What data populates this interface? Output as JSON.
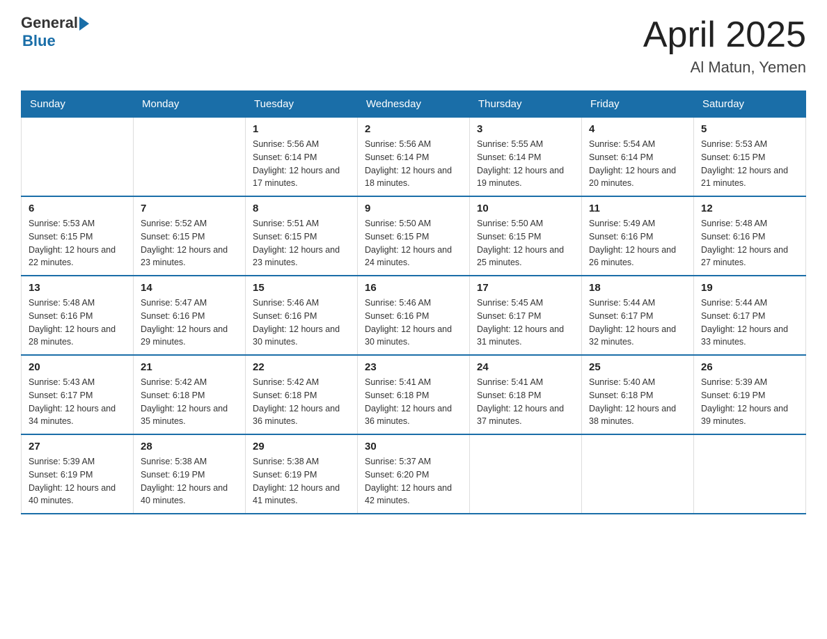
{
  "logo": {
    "general": "General",
    "blue": "Blue"
  },
  "title": "April 2025",
  "subtitle": "Al Matun, Yemen",
  "days_header": [
    "Sunday",
    "Monday",
    "Tuesday",
    "Wednesday",
    "Thursday",
    "Friday",
    "Saturday"
  ],
  "weeks": [
    [
      {
        "day": "",
        "sunrise": "",
        "sunset": "",
        "daylight": ""
      },
      {
        "day": "",
        "sunrise": "",
        "sunset": "",
        "daylight": ""
      },
      {
        "day": "1",
        "sunrise": "Sunrise: 5:56 AM",
        "sunset": "Sunset: 6:14 PM",
        "daylight": "Daylight: 12 hours and 17 minutes."
      },
      {
        "day": "2",
        "sunrise": "Sunrise: 5:56 AM",
        "sunset": "Sunset: 6:14 PM",
        "daylight": "Daylight: 12 hours and 18 minutes."
      },
      {
        "day": "3",
        "sunrise": "Sunrise: 5:55 AM",
        "sunset": "Sunset: 6:14 PM",
        "daylight": "Daylight: 12 hours and 19 minutes."
      },
      {
        "day": "4",
        "sunrise": "Sunrise: 5:54 AM",
        "sunset": "Sunset: 6:14 PM",
        "daylight": "Daylight: 12 hours and 20 minutes."
      },
      {
        "day": "5",
        "sunrise": "Sunrise: 5:53 AM",
        "sunset": "Sunset: 6:15 PM",
        "daylight": "Daylight: 12 hours and 21 minutes."
      }
    ],
    [
      {
        "day": "6",
        "sunrise": "Sunrise: 5:53 AM",
        "sunset": "Sunset: 6:15 PM",
        "daylight": "Daylight: 12 hours and 22 minutes."
      },
      {
        "day": "7",
        "sunrise": "Sunrise: 5:52 AM",
        "sunset": "Sunset: 6:15 PM",
        "daylight": "Daylight: 12 hours and 23 minutes."
      },
      {
        "day": "8",
        "sunrise": "Sunrise: 5:51 AM",
        "sunset": "Sunset: 6:15 PM",
        "daylight": "Daylight: 12 hours and 23 minutes."
      },
      {
        "day": "9",
        "sunrise": "Sunrise: 5:50 AM",
        "sunset": "Sunset: 6:15 PM",
        "daylight": "Daylight: 12 hours and 24 minutes."
      },
      {
        "day": "10",
        "sunrise": "Sunrise: 5:50 AM",
        "sunset": "Sunset: 6:15 PM",
        "daylight": "Daylight: 12 hours and 25 minutes."
      },
      {
        "day": "11",
        "sunrise": "Sunrise: 5:49 AM",
        "sunset": "Sunset: 6:16 PM",
        "daylight": "Daylight: 12 hours and 26 minutes."
      },
      {
        "day": "12",
        "sunrise": "Sunrise: 5:48 AM",
        "sunset": "Sunset: 6:16 PM",
        "daylight": "Daylight: 12 hours and 27 minutes."
      }
    ],
    [
      {
        "day": "13",
        "sunrise": "Sunrise: 5:48 AM",
        "sunset": "Sunset: 6:16 PM",
        "daylight": "Daylight: 12 hours and 28 minutes."
      },
      {
        "day": "14",
        "sunrise": "Sunrise: 5:47 AM",
        "sunset": "Sunset: 6:16 PM",
        "daylight": "Daylight: 12 hours and 29 minutes."
      },
      {
        "day": "15",
        "sunrise": "Sunrise: 5:46 AM",
        "sunset": "Sunset: 6:16 PM",
        "daylight": "Daylight: 12 hours and 30 minutes."
      },
      {
        "day": "16",
        "sunrise": "Sunrise: 5:46 AM",
        "sunset": "Sunset: 6:16 PM",
        "daylight": "Daylight: 12 hours and 30 minutes."
      },
      {
        "day": "17",
        "sunrise": "Sunrise: 5:45 AM",
        "sunset": "Sunset: 6:17 PM",
        "daylight": "Daylight: 12 hours and 31 minutes."
      },
      {
        "day": "18",
        "sunrise": "Sunrise: 5:44 AM",
        "sunset": "Sunset: 6:17 PM",
        "daylight": "Daylight: 12 hours and 32 minutes."
      },
      {
        "day": "19",
        "sunrise": "Sunrise: 5:44 AM",
        "sunset": "Sunset: 6:17 PM",
        "daylight": "Daylight: 12 hours and 33 minutes."
      }
    ],
    [
      {
        "day": "20",
        "sunrise": "Sunrise: 5:43 AM",
        "sunset": "Sunset: 6:17 PM",
        "daylight": "Daylight: 12 hours and 34 minutes."
      },
      {
        "day": "21",
        "sunrise": "Sunrise: 5:42 AM",
        "sunset": "Sunset: 6:18 PM",
        "daylight": "Daylight: 12 hours and 35 minutes."
      },
      {
        "day": "22",
        "sunrise": "Sunrise: 5:42 AM",
        "sunset": "Sunset: 6:18 PM",
        "daylight": "Daylight: 12 hours and 36 minutes."
      },
      {
        "day": "23",
        "sunrise": "Sunrise: 5:41 AM",
        "sunset": "Sunset: 6:18 PM",
        "daylight": "Daylight: 12 hours and 36 minutes."
      },
      {
        "day": "24",
        "sunrise": "Sunrise: 5:41 AM",
        "sunset": "Sunset: 6:18 PM",
        "daylight": "Daylight: 12 hours and 37 minutes."
      },
      {
        "day": "25",
        "sunrise": "Sunrise: 5:40 AM",
        "sunset": "Sunset: 6:18 PM",
        "daylight": "Daylight: 12 hours and 38 minutes."
      },
      {
        "day": "26",
        "sunrise": "Sunrise: 5:39 AM",
        "sunset": "Sunset: 6:19 PM",
        "daylight": "Daylight: 12 hours and 39 minutes."
      }
    ],
    [
      {
        "day": "27",
        "sunrise": "Sunrise: 5:39 AM",
        "sunset": "Sunset: 6:19 PM",
        "daylight": "Daylight: 12 hours and 40 minutes."
      },
      {
        "day": "28",
        "sunrise": "Sunrise: 5:38 AM",
        "sunset": "Sunset: 6:19 PM",
        "daylight": "Daylight: 12 hours and 40 minutes."
      },
      {
        "day": "29",
        "sunrise": "Sunrise: 5:38 AM",
        "sunset": "Sunset: 6:19 PM",
        "daylight": "Daylight: 12 hours and 41 minutes."
      },
      {
        "day": "30",
        "sunrise": "Sunrise: 5:37 AM",
        "sunset": "Sunset: 6:20 PM",
        "daylight": "Daylight: 12 hours and 42 minutes."
      },
      {
        "day": "",
        "sunrise": "",
        "sunset": "",
        "daylight": ""
      },
      {
        "day": "",
        "sunrise": "",
        "sunset": "",
        "daylight": ""
      },
      {
        "day": "",
        "sunrise": "",
        "sunset": "",
        "daylight": ""
      }
    ]
  ]
}
